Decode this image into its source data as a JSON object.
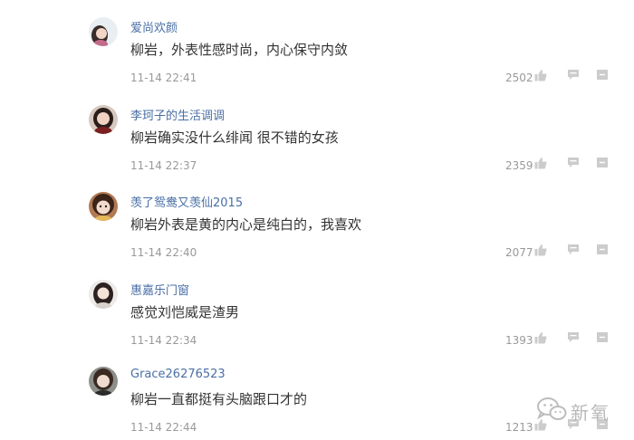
{
  "comments": [
    {
      "username": "爱尚欢颜",
      "text": "柳岩，外表性感时尚，内心保守内敛",
      "time": "11-14 22:41",
      "likes": "2502"
    },
    {
      "username": "李珂子的生活调调",
      "text": "柳岩确实没什么绯闻 很不错的女孩",
      "time": "11-14 22:37",
      "likes": "2359"
    },
    {
      "username": "羡了鸳鸯又羡仙2015",
      "text": "柳岩外表是黄的内心是纯白的，我喜欢",
      "time": "11-14 22:40",
      "likes": "2077"
    },
    {
      "username": "惠嘉乐门窗",
      "text": "感觉刘恺威是渣男",
      "time": "11-14 22:34",
      "likes": "1393"
    },
    {
      "username": "Grace26276523",
      "text": "柳岩一直都挺有头脑跟口才的",
      "time": "11-14 22:44",
      "likes": "1213"
    }
  ],
  "watermark": {
    "text": "新氧",
    "icon": "wechat-logo-icon"
  },
  "icons": {
    "like": "thumbs-up-icon",
    "reply": "reply-bubble-icon",
    "more": "more-icon"
  },
  "colors": {
    "username": "#4a6fa5",
    "text": "#333333",
    "meta": "#999999",
    "icon": "#cccccc"
  }
}
